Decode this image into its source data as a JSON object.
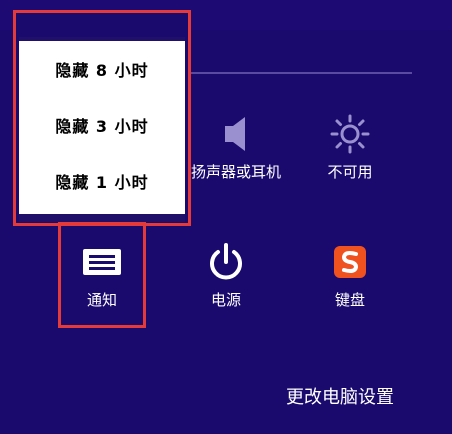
{
  "hide_notifications_menu": {
    "items": [
      {
        "label": "隐藏 8 小时"
      },
      {
        "label": "隐藏 3 小时"
      },
      {
        "label": "隐藏 1 小时"
      }
    ]
  },
  "tiles": {
    "speakers": {
      "label": "扬声器或耳机",
      "icon": "speaker-icon"
    },
    "brightness": {
      "label": "不可用",
      "icon": "brightness-icon"
    },
    "notifications": {
      "label": "通知",
      "icon": "notifications-icon"
    },
    "power": {
      "label": "电源",
      "icon": "power-icon"
    },
    "keyboard": {
      "label": "键盘",
      "icon": "sogou-ime-icon"
    }
  },
  "footer": {
    "change_pc_settings": "更改电脑设置"
  },
  "colors": {
    "background": "#1b0a6e",
    "highlight_border": "#e53a3a",
    "ime_brand": "#f0521f"
  }
}
